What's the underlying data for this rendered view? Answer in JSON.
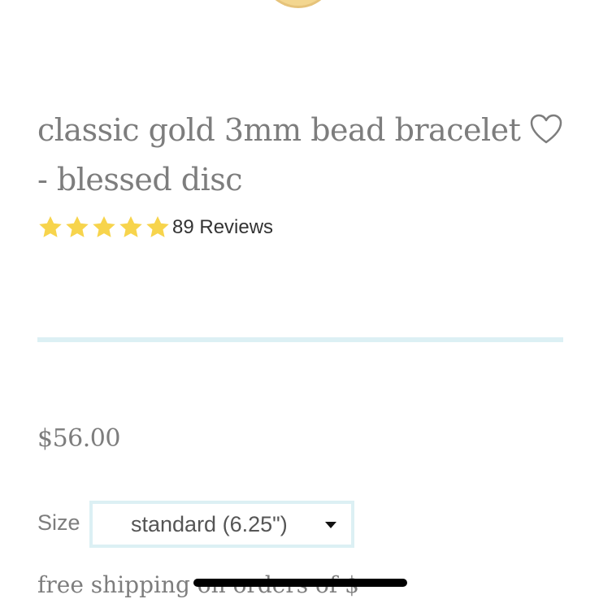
{
  "product": {
    "title": "classic gold 3mm bead bracelet - blessed disc",
    "rating": {
      "stars": 5,
      "max": 5,
      "reviews_label": "89 Reviews"
    },
    "price": "$56.00",
    "size": {
      "label": "Size",
      "selected": "standard (6.25\")"
    },
    "partial_text": "free shipping on orders of $"
  },
  "colors": {
    "title": "#7d7d7d",
    "star": "#f7d44c",
    "divider": "#dcf0f4",
    "select_border": "#dcf0f4"
  },
  "icons": {
    "wishlist": "heart-outline-icon",
    "star": "star-icon",
    "dropdown": "caret-down-icon"
  }
}
